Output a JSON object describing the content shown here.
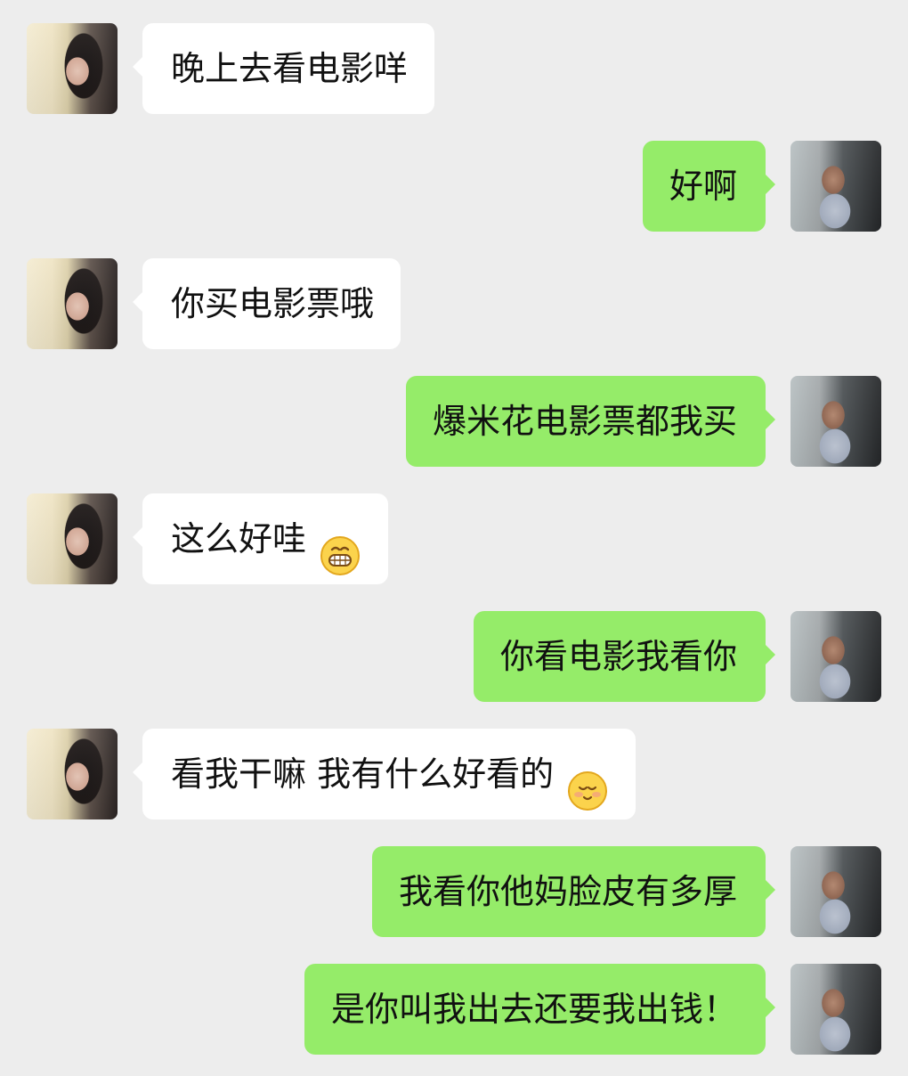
{
  "chat": {
    "messages": [
      {
        "side": "incoming",
        "text": "晚上去看电影咩"
      },
      {
        "side": "outgoing",
        "text": "好啊"
      },
      {
        "side": "incoming",
        "text": "你买电影票哦"
      },
      {
        "side": "outgoing",
        "text": "爆米花电影票都我买"
      },
      {
        "side": "incoming",
        "text": "这么好哇",
        "emoji": "grin-emoji"
      },
      {
        "side": "outgoing",
        "text": "你看电影我看你"
      },
      {
        "side": "incoming",
        "text": "看我干嘛 我有什么好看的",
        "emoji": "shy-smile-emoji"
      },
      {
        "side": "outgoing",
        "text": "我看你他妈脸皮有多厚"
      },
      {
        "side": "outgoing",
        "text": "是你叫我出去还要我出钱！"
      }
    ]
  },
  "colors": {
    "background": "#ededed",
    "incoming_bubble": "#ffffff",
    "outgoing_bubble": "#95ec69",
    "text": "#111111"
  }
}
